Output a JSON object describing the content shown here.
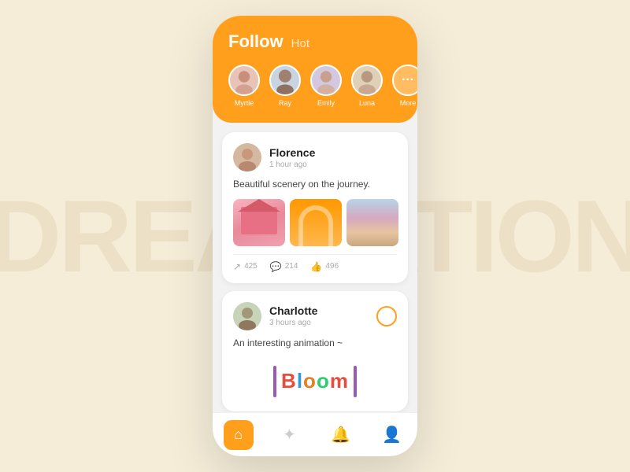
{
  "watermark": "DREAMATION",
  "header": {
    "tab_follow": "Follow",
    "tab_hot": "Hot"
  },
  "avatars": [
    {
      "name": "Myrtle",
      "color": "#e8c4b8"
    },
    {
      "name": "Ray",
      "color": "#c8d4e8"
    },
    {
      "name": "Emily",
      "color": "#d4c8e8"
    },
    {
      "name": "Luna",
      "color": "#e8d4b8"
    },
    {
      "name": "More",
      "is_more": true
    }
  ],
  "posts": [
    {
      "user": "Florence",
      "time": "1 hour ago",
      "text": "Beautiful scenery on the journey.",
      "stats": {
        "shares": "425",
        "comments": "214",
        "likes": "496"
      }
    },
    {
      "user": "Charlotte",
      "time": "3 hours ago",
      "text": "An interesting animation ~",
      "bloom_text": "Bloom"
    }
  ],
  "nav": {
    "items": [
      "home",
      "explore",
      "notifications",
      "profile"
    ]
  }
}
